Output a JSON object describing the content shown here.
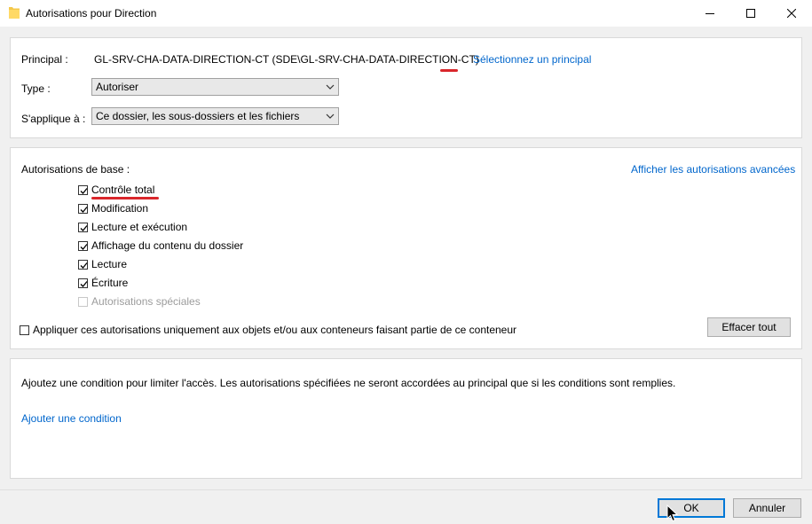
{
  "window": {
    "title": "Autorisations pour Direction",
    "folder_icon": "folder-icon",
    "controls": [
      "minimize-icon",
      "maximize-icon",
      "close-icon"
    ]
  },
  "principal": {
    "label": "Principal :",
    "value": "GL-SRV-CHA-DATA-DIRECTION-CT (SDE\\GL-SRV-CHA-DATA-DIRECTION-CT)",
    "select_link": "Sélectionnez un principal"
  },
  "type": {
    "label": "Type :",
    "value": "Autoriser"
  },
  "applies_to": {
    "label": "S'applique à :",
    "value": "Ce dossier, les sous-dossiers et les fichiers"
  },
  "permissions": {
    "heading": "Autorisations de base :",
    "advanced_link": "Afficher les autorisations avancées",
    "items": [
      {
        "label": "Contrôle total",
        "checked": true,
        "enabled": true
      },
      {
        "label": "Modification",
        "checked": true,
        "enabled": true
      },
      {
        "label": "Lecture et exécution",
        "checked": true,
        "enabled": true
      },
      {
        "label": "Affichage du contenu du dossier",
        "checked": true,
        "enabled": true
      },
      {
        "label": "Lecture",
        "checked": true,
        "enabled": true
      },
      {
        "label": "Écriture",
        "checked": true,
        "enabled": true
      },
      {
        "label": "Autorisations spéciales",
        "checked": false,
        "enabled": false
      }
    ],
    "apply_only_label": "Appliquer ces autorisations uniquement aux objets et/ou aux conteneurs faisant partie de ce conteneur",
    "apply_only_checked": false,
    "clear_button": "Effacer tout"
  },
  "condition": {
    "description": "Ajoutez une condition pour limiter l'accès. Les autorisations spécifiées ne seront accordées au principal que si les conditions sont remplies.",
    "add_link": "Ajouter une condition"
  },
  "footer": {
    "ok": "OK",
    "cancel": "Annuler"
  },
  "colors": {
    "link": "#0066cc",
    "accent": "#0078d7",
    "annotation": "#d9262b"
  }
}
